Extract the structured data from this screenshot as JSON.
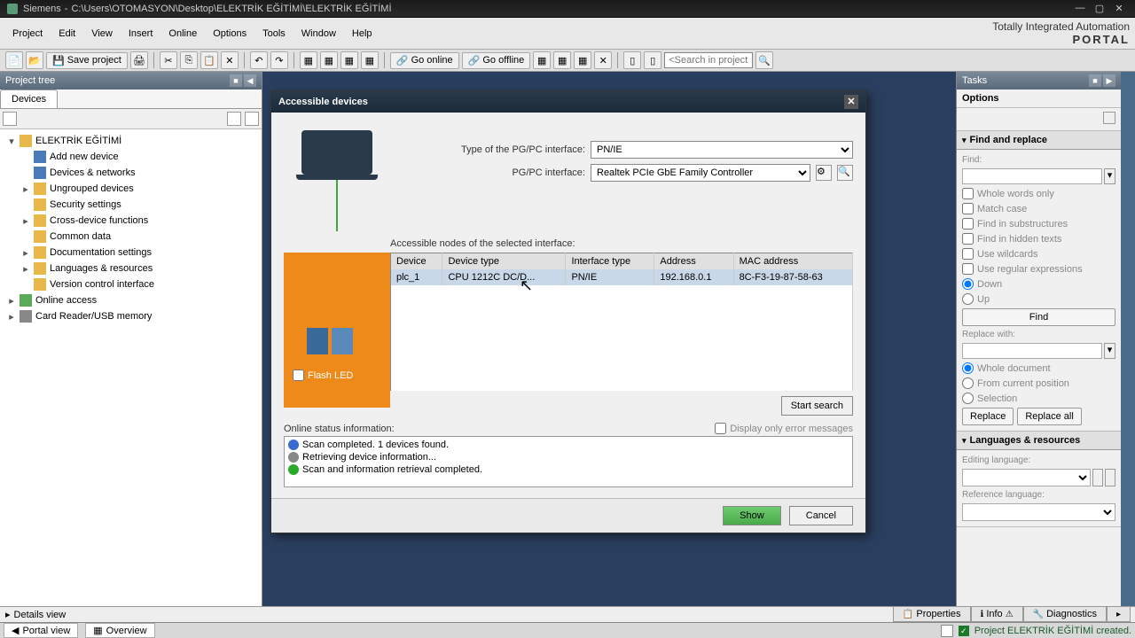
{
  "title": {
    "app": "Siemens",
    "path": "C:\\Users\\OTOMASYON\\Desktop\\ELEKTRİK EĞİTİMİ\\ELEKTRİK EĞİTİMİ"
  },
  "menu": {
    "items": [
      "Project",
      "Edit",
      "View",
      "Insert",
      "Online",
      "Options",
      "Tools",
      "Window",
      "Help"
    ]
  },
  "brand": {
    "line1": "Totally Integrated Automation",
    "line2": "PORTAL"
  },
  "toolbar": {
    "save": "Save project",
    "goonline": "Go online",
    "gooffline": "Go offline",
    "search_placeholder": "<Search in project>"
  },
  "left": {
    "title": "Project tree",
    "tab": "Devices",
    "items": [
      {
        "lvl": 1,
        "exp": "▾",
        "icon": "folder",
        "label": "ELEKTRİK EĞİTİMİ"
      },
      {
        "lvl": 2,
        "exp": "",
        "icon": "device",
        "label": "Add new device"
      },
      {
        "lvl": 2,
        "exp": "",
        "icon": "device",
        "label": "Devices & networks"
      },
      {
        "lvl": 2,
        "exp": "▸",
        "icon": "folder",
        "label": "Ungrouped devices"
      },
      {
        "lvl": 2,
        "exp": "",
        "icon": "folder",
        "label": "Security settings"
      },
      {
        "lvl": 2,
        "exp": "▸",
        "icon": "folder",
        "label": "Cross-device functions"
      },
      {
        "lvl": 2,
        "exp": "",
        "icon": "folder",
        "label": "Common data"
      },
      {
        "lvl": 2,
        "exp": "▸",
        "icon": "folder",
        "label": "Documentation settings"
      },
      {
        "lvl": 2,
        "exp": "▸",
        "icon": "folder",
        "label": "Languages & resources"
      },
      {
        "lvl": 2,
        "exp": "",
        "icon": "folder",
        "label": "Version control interface"
      },
      {
        "lvl": 1,
        "exp": "▸",
        "icon": "green",
        "label": "Online access"
      },
      {
        "lvl": 1,
        "exp": "▸",
        "icon": "gray",
        "label": "Card Reader/USB memory"
      }
    ]
  },
  "dialog": {
    "title": "Accessible devices",
    "type_label": "Type of the PG/PC interface:",
    "type_value": "PN/IE",
    "if_label": "PG/PC interface:",
    "if_value": "Realtek PCIe GbE Family Controller",
    "list_label": "Accessible nodes of the selected interface:",
    "flash": "Flash LED",
    "cols": [
      "Device",
      "Device type",
      "Interface type",
      "Address",
      "MAC address"
    ],
    "row": {
      "device": "plc_1",
      "devtype": "CPU 1212C DC/D...",
      "iftype": "PN/IE",
      "addr": "192.168.0.1",
      "mac": "8C-F3-19-87-58-63"
    },
    "startsearch": "Start search",
    "status_label": "Online status information:",
    "only_err": "Display only error messages",
    "log": [
      {
        "color": "#3a6acc",
        "text": "Scan completed. 1 devices found."
      },
      {
        "color": "#888888",
        "text": "Retrieving device information..."
      },
      {
        "color": "#2aaa2a",
        "text": "Scan and information retrieval completed."
      }
    ],
    "show": "Show",
    "cancel": "Cancel"
  },
  "right": {
    "tasks": "Tasks",
    "options": "Options",
    "find": {
      "title": "Find and replace",
      "find_label": "Find:",
      "whole": "Whole words only",
      "matchcase": "Match case",
      "sub": "Find in substructures",
      "hidden": "Find in hidden texts",
      "wildcards": "Use wildcards",
      "regex": "Use regular expressions",
      "down": "Down",
      "up": "Up",
      "findbtn": "Find",
      "replace_label": "Replace with:",
      "whole_doc": "Whole document",
      "from_cur": "From current position",
      "selection": "Selection",
      "replace": "Replace",
      "replaceall": "Replace all"
    },
    "lang": {
      "title": "Languages & resources",
      "edit_label": "Editing language:",
      "ref_label": "Reference language:"
    }
  },
  "details": {
    "title": "Details view"
  },
  "proptabs": {
    "properties": "Properties",
    "info": "Info",
    "diagnostics": "Diagnostics"
  },
  "bottom": {
    "portal": "Portal view",
    "overview": "Overview",
    "status": "Project ELEKTRİK EĞİTİMİ created."
  }
}
